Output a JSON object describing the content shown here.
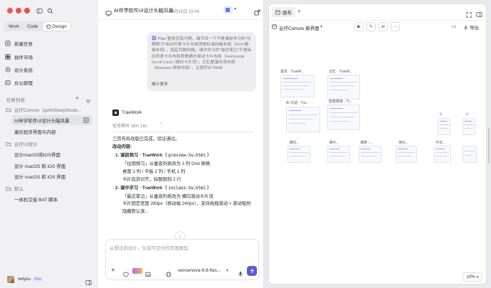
{
  "sidebar": {
    "mode_tabs": [
      "Work",
      "Code",
      "Design"
    ],
    "active_mode": "Design",
    "nav": [
      {
        "label": "新建任务",
        "icon": "new-task-icon"
      },
      {
        "label": "插件市场",
        "icon": "plugin-icon"
      },
      {
        "label": "设计系统",
        "icon": "design-system-icon"
      },
      {
        "label": "办公助理",
        "icon": "assistant-icon"
      }
    ],
    "task_list_title": "任务列表",
    "groups": [
      {
        "title": "云仔Cumulo（getInDeepStude...",
        "tasks": [
          "AI伴学软件UI设计头脑风暴",
          "遍历程序界面与内容"
        ]
      },
      {
        "title": "云仔UI设计",
        "tasks": [
          "设计macOS和iOS界面",
          "设计 macOS 和 iOS 界面",
          "设计 macOS 和 iOS 界面"
        ]
      },
      {
        "title": "默认",
        "tasks": [
          "一体机交接 BAT 脚本"
        ]
      }
    ],
    "user": {
      "name": "xwyxu",
      "badge": "Pro"
    }
  },
  "chat": {
    "title": "AI伴学软件UI设计头脑风暴",
    "date": "08月15日 15:44",
    "plan_label": "Plan",
    "plan_text": "整体没有问题，细节改一下不是课前学习的\"往期预习\"纵向列表卡片布局而是标准网格布局（Grid 栅格布局），固定列数网格；课中学习的\"最近笔记\"不是纵向列表卡片布局而是横向滚动卡片布局（Horizontal Scroll Card / 横向卡片流）；记忆是瀑布流布局（Masonry 砌体布局），注意符合TRAE",
    "show_more": "展示更多",
    "agent_name": "TraeWork",
    "task_time": "任务耗时 18m 18s",
    "lines": [
      "三页布局改版已完成，验证通过。",
      "改动内容:",
      "1. 课前预习 · TraeWork（",
      "preview-tw.html",
      "）",
      "「往期预习」从垂直列表改为 3 列 Grid 网格",
      "桌面 3 列 / 平板 2 列 / 手机 1 列",
      "卡片底部对齐，标题限制 2 行",
      "2. 课中学习 · TraeWork（",
      "inclass-tw.html",
      "）",
      "「最近笔记」从垂直列表改为 横向滚动卡片流",
      "卡片固定宽度 280px（移动端 240px），支持拖拽滚动 + 滚动吸附",
      "隐藏默认滚..."
    ],
    "input_placeholder": "从想法到设计，生成可交付的页面原型",
    "model": "sensenova-6.8-flas..."
  },
  "canvas": {
    "tab_label": "画布",
    "project": "云仔Cumulo 新界面",
    "export_label": "导出",
    "zoom": "10%",
    "frames": [
      "首页 · TraeW...",
      "记忆 · TraeW...",
      "AI 对话 · Tra...",
      "智能题库 · Tr...",
      "课前...",
      "课中...",
      "课表 -...",
      "待办...",
      "今日...",
      "个",
      "个"
    ]
  },
  "colors": {
    "accent": "#5b5bd6",
    "panel_bg": "#f1f1f4"
  }
}
